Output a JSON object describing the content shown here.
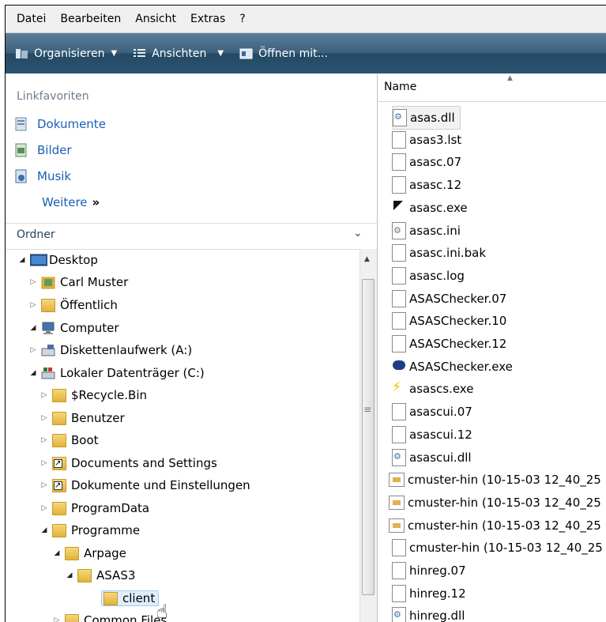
{
  "menubar": [
    "Datei",
    "Bearbeiten",
    "Ansicht",
    "Extras",
    "?"
  ],
  "toolbar": {
    "organize": "Organisieren",
    "views": "Ansichten",
    "open_with": "Öffnen mit..."
  },
  "favorites": {
    "title": "Linkfavoriten",
    "items": [
      "Dokumente",
      "Bilder",
      "Musik"
    ],
    "more": "Weitere",
    "more_chevron": "»"
  },
  "folders": {
    "title": "Ordner",
    "tree": [
      {
        "label": "Desktop",
        "level": 0,
        "expanded": true,
        "icon": "desktop-icon"
      },
      {
        "label": "Carl Muster",
        "level": 1,
        "expanded": false,
        "icon": "user-folder-icon"
      },
      {
        "label": "Öffentlich",
        "level": 1,
        "expanded": false,
        "icon": "folder-icon"
      },
      {
        "label": "Computer",
        "level": 1,
        "expanded": true,
        "icon": "computer-icon"
      },
      {
        "label": "Diskettenlaufwerk (A:)",
        "level": 2,
        "expanded": false,
        "icon": "floppy-drive-icon"
      },
      {
        "label": "Lokaler Datenträger (C:)",
        "level": 2,
        "expanded": true,
        "icon": "hard-drive-icon"
      },
      {
        "label": "$Recycle.Bin",
        "level": 3,
        "expanded": false,
        "icon": "folder-icon"
      },
      {
        "label": "Benutzer",
        "level": 3,
        "expanded": false,
        "icon": "folder-icon"
      },
      {
        "label": "Boot",
        "level": 3,
        "expanded": false,
        "icon": "folder-icon"
      },
      {
        "label": "Documents and Settings",
        "level": 3,
        "expanded": false,
        "icon": "folder-shortcut-icon"
      },
      {
        "label": "Dokumente und Einstellungen",
        "level": 3,
        "expanded": false,
        "icon": "folder-shortcut-icon"
      },
      {
        "label": "ProgramData",
        "level": 3,
        "expanded": false,
        "icon": "folder-icon"
      },
      {
        "label": "Programme",
        "level": 3,
        "expanded": true,
        "icon": "folder-icon"
      },
      {
        "label": "Arpage",
        "level": 4,
        "expanded": true,
        "icon": "folder-icon"
      },
      {
        "label": "ASAS3",
        "level": 5,
        "expanded": true,
        "icon": "folder-icon"
      },
      {
        "label": "client",
        "level": 6,
        "expanded": null,
        "icon": "folder-icon",
        "selected": true
      },
      {
        "label": "Common Files",
        "level": 4,
        "expanded": false,
        "icon": "folder-icon"
      }
    ]
  },
  "files": {
    "column_name": "Name",
    "items": [
      {
        "name": "asas.dll",
        "type": "dll"
      },
      {
        "name": "asas3.lst",
        "type": "doc"
      },
      {
        "name": "asasc.07",
        "type": "doc"
      },
      {
        "name": "asasc.12",
        "type": "doc"
      },
      {
        "name": "asasc.exe",
        "type": "exe-a"
      },
      {
        "name": "asasc.ini",
        "type": "ini"
      },
      {
        "name": "asasc.ini.bak",
        "type": "doc"
      },
      {
        "name": "asasc.log",
        "type": "doc"
      },
      {
        "name": "ASASChecker.07",
        "type": "doc"
      },
      {
        "name": "ASASChecker.10",
        "type": "doc"
      },
      {
        "name": "ASASChecker.12",
        "type": "doc"
      },
      {
        "name": "ASASChecker.exe",
        "type": "exe-b"
      },
      {
        "name": "asascs.exe",
        "type": "exe-c"
      },
      {
        "name": "asascui.07",
        "type": "doc"
      },
      {
        "name": "asascui.12",
        "type": "doc"
      },
      {
        "name": "asascui.dll",
        "type": "dll"
      },
      {
        "name": "cmuster-hin (10-15-03 12_40_25",
        "type": "cert"
      },
      {
        "name": "cmuster-hin (10-15-03 12_40_25",
        "type": "cert"
      },
      {
        "name": "cmuster-hin (10-15-03 12_40_25",
        "type": "cert"
      },
      {
        "name": "cmuster-hin (10-15-03 12_40_25",
        "type": "doc"
      },
      {
        "name": "hinreg.07",
        "type": "doc"
      },
      {
        "name": "hinreg.12",
        "type": "doc"
      },
      {
        "name": "hinreg.dll",
        "type": "dll"
      }
    ]
  },
  "colors": {
    "link": "#1a5fb4",
    "toolbar_top": "#5a7e98",
    "toolbar_bottom": "#234964",
    "selection": "#dfeefb"
  }
}
